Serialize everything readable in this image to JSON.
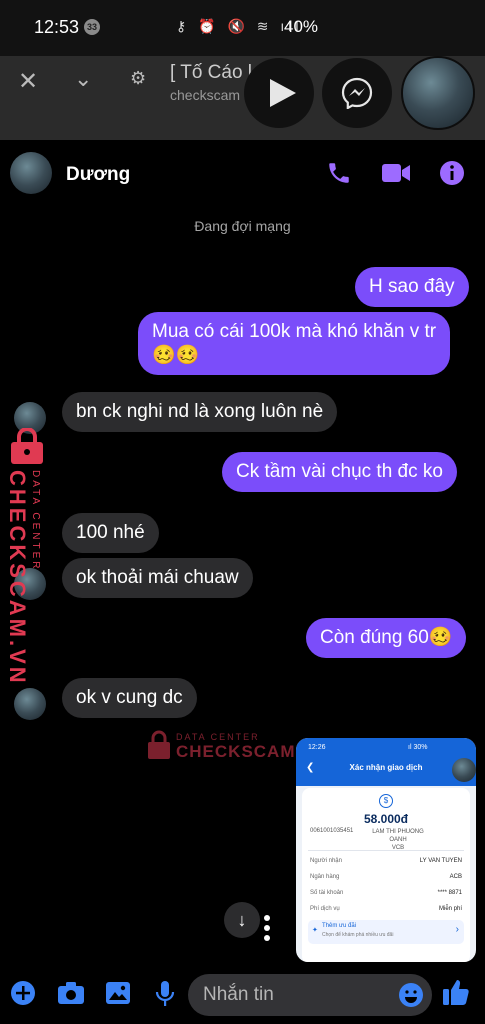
{
  "status_bar": {
    "time": "12:53",
    "notif_count": "33",
    "icons": "⚷ ⏰ 🔇 ≋ ıll",
    "battery": "40%"
  },
  "browser": {
    "title": "[ Tố Cáo l",
    "url": "checkscam"
  },
  "chat": {
    "contact_name": "Dương",
    "network_status": "Đang đợi mạng",
    "messages": [
      {
        "dir": "out",
        "text": "H sao đây"
      },
      {
        "dir": "out",
        "text": "Mua có cái 100k mà khó khăn v tr",
        "text2": "🥴🥴"
      },
      {
        "dir": "in",
        "text": "bn ck nghi nd là xong luôn nè"
      },
      {
        "dir": "out",
        "text": "Ck tầm vài chục th đc ko"
      },
      {
        "dir": "in",
        "text": "100 nhé"
      },
      {
        "dir": "in",
        "text": "ok thoải mái chuaw"
      },
      {
        "dir": "out",
        "text": "Còn đúng 60🥴"
      },
      {
        "dir": "in",
        "text": "ok v cung dc"
      }
    ]
  },
  "watermark": {
    "brand": "CHECKSCAM.VN",
    "tagline": "DATA CENTER"
  },
  "bank_screenshot": {
    "time": "12:26",
    "status": "ıl 30%",
    "title": "Xác nhận giao dịch",
    "amount": "58.000đ",
    "account": "0061001035451",
    "holder": "LAM THI PHUONG OANH",
    "holder_bank": "VCB",
    "rows": [
      {
        "label": "Người nhận",
        "value": "LY VAN TUYEN"
      },
      {
        "label": "Ngân hàng",
        "value": "ACB"
      },
      {
        "label": "Số tài khoản",
        "value": "**** 8871"
      },
      {
        "label": "Phí dịch vụ",
        "value": "Miễn phí"
      }
    ],
    "promo_title": "Thêm ưu đãi",
    "promo_sub": "Chọn để khám phá nhiều ưu đãi"
  },
  "composer": {
    "placeholder": "Nhắn tin"
  },
  "colors": {
    "accent": "#7b4dfa",
    "incoming_bubble": "#2c2c2e",
    "watermark": "#e03a52",
    "bank_blue": "#1565d8"
  }
}
